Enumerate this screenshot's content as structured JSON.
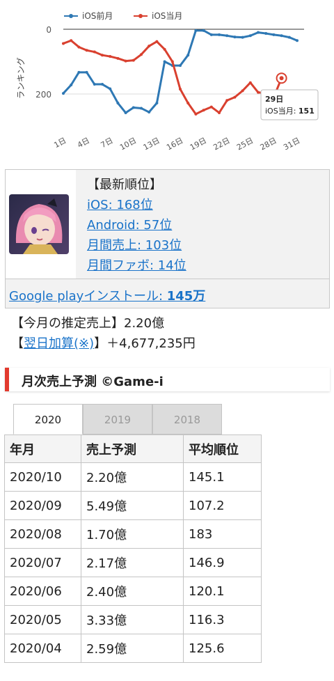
{
  "chart_data": {
    "type": "line",
    "ylabel": "ランキング",
    "y_ticks": [
      "0",
      "200"
    ],
    "y_range_top": 0,
    "y_range_bottom": 310,
    "inverted_axis": true,
    "x_tick_labels": [
      "1日",
      "4日",
      "7日",
      "10日",
      "13日",
      "16日",
      "19日",
      "22日",
      "25日",
      "28日",
      "31日"
    ],
    "x_days": [
      1,
      2,
      3,
      4,
      5,
      6,
      7,
      8,
      9,
      10,
      11,
      12,
      13,
      14,
      15,
      16,
      17,
      18,
      19,
      20,
      21,
      22,
      23,
      24,
      25,
      26,
      27,
      28,
      29,
      30,
      31
    ],
    "legend_position": "top",
    "series": [
      {
        "name": "iOS前月",
        "color": "#2e78b4",
        "values": [
          198,
          172,
          133,
          133,
          170,
          170,
          184,
          228,
          258,
          242,
          244,
          256,
          228,
          100,
          112,
          112,
          80,
          4,
          4,
          17,
          17,
          20,
          24,
          25,
          20,
          10,
          13,
          17,
          20,
          25,
          35
        ]
      },
      {
        "name": "iOS当月",
        "color": "#d9402f",
        "values": [
          44,
          35,
          55,
          65,
          70,
          80,
          84,
          90,
          98,
          96,
          78,
          52,
          38,
          62,
          100,
          185,
          228,
          262,
          250,
          240,
          258,
          220,
          210,
          190,
          165,
          195,
          198,
          210,
          151
        ]
      }
    ],
    "tooltip": {
      "day_label": "29日",
      "series_label": "iOS当月",
      "value": "151"
    }
  },
  "game": {
    "rank_heading": "【最新順位】",
    "ios": "iOS: 168位",
    "android": "Android: 57位",
    "monthly_sales": "月間売上: 103位",
    "monthly_fav": "月間ファボ: 14位",
    "install_label": "Google playインストール: ",
    "install_value": "145万",
    "sales_line": "【今月の推定売上】2.20億",
    "next_day_prefix": "【",
    "next_day_link": "翌日加算(※)",
    "next_day_suffix": "】＋4,677,235円"
  },
  "section": {
    "title": "月次売上予測 ©Game-i"
  },
  "tabs": [
    "2020",
    "2019",
    "2018"
  ],
  "table": {
    "headers": [
      "年月",
      "売上予測",
      "平均順位"
    ],
    "rows": [
      [
        "2020/10",
        "2.20億",
        "145.1"
      ],
      [
        "2020/09",
        "5.49億",
        "107.2"
      ],
      [
        "2020/08",
        "1.70億",
        "183"
      ],
      [
        "2020/07",
        "2.17億",
        "146.9"
      ],
      [
        "2020/06",
        "2.40億",
        "120.1"
      ],
      [
        "2020/05",
        "3.33億",
        "116.3"
      ],
      [
        "2020/04",
        "2.59億",
        "125.6"
      ]
    ]
  }
}
